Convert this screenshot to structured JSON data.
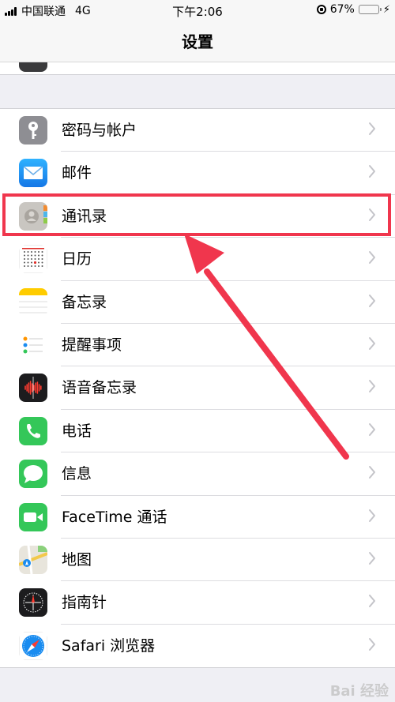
{
  "status_bar": {
    "carrier": "中国联通",
    "network": "4G",
    "time": "下午2:06",
    "battery_percent": "67%",
    "battery_level": 0.67,
    "battery_color": "#f5c518"
  },
  "nav": {
    "title": "设置"
  },
  "settings_items": [
    {
      "label": "密码与帐户",
      "icon": "key-icon",
      "color": "#8e8e93"
    },
    {
      "label": "邮件",
      "icon": "mail-icon",
      "color": "#1a8cf0"
    },
    {
      "label": "通讯录",
      "icon": "contacts-icon",
      "color": "#c9c6c1"
    },
    {
      "label": "日历",
      "icon": "calendar-icon",
      "color": "#ffffff"
    },
    {
      "label": "备忘录",
      "icon": "notes-icon",
      "color": "#ffffff"
    },
    {
      "label": "提醒事项",
      "icon": "reminders-icon",
      "color": "#ffffff"
    },
    {
      "label": "语音备忘录",
      "icon": "voice-memos-icon",
      "color": "#1c1c1e"
    },
    {
      "label": "电话",
      "icon": "phone-icon",
      "color": "#34c759"
    },
    {
      "label": "信息",
      "icon": "messages-icon",
      "color": "#34c759"
    },
    {
      "label": "FaceTime 通话",
      "icon": "facetime-icon",
      "color": "#34c759"
    },
    {
      "label": "地图",
      "icon": "maps-icon",
      "color": "#e8e8e8"
    },
    {
      "label": "指南针",
      "icon": "compass-icon",
      "color": "#1c1c1e"
    },
    {
      "label": "Safari 浏览器",
      "icon": "safari-icon",
      "color": "#ffffff"
    }
  ],
  "annotation": {
    "highlight_color": "#f0364d"
  },
  "watermark": "Bai 经验"
}
